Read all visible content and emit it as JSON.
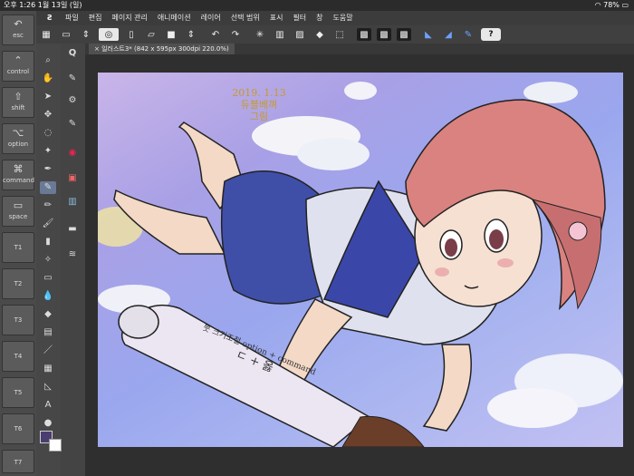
{
  "status": {
    "time": "오후 1:26",
    "date": "1월 13일 (일)",
    "battery": "78%"
  },
  "menu": {
    "items": [
      "파일",
      "편집",
      "페이지 관리",
      "애니메이션",
      "레이어",
      "선택 범위",
      "표시",
      "필터",
      "창",
      "도움말"
    ]
  },
  "keys": [
    {
      "label": "esc",
      "icon": "↶"
    },
    {
      "label": "control",
      "icon": "⌃"
    },
    {
      "label": "shift",
      "icon": "⇧"
    },
    {
      "label": "option",
      "icon": "⌥"
    },
    {
      "label": "command",
      "icon": "⌘"
    },
    {
      "label": "space",
      "icon": "▭"
    }
  ],
  "fkeys": [
    "T1",
    "T2",
    "T3",
    "T4",
    "T5",
    "T6",
    "T7"
  ],
  "tab": {
    "label": "일러스트3* (842 x 595px 300dpi 220.0%)"
  },
  "art": {
    "note_line1": "2019. 1.13",
    "note_line2": "듀블베껴",
    "note_line3": "그림",
    "board_text1": "붓 크기조절 option + command",
    "board_text2": "ㄷ + 옳"
  },
  "toolbar": {
    "help": "?"
  },
  "colors": {
    "main": "#4a3d70",
    "sub": "#ffffff"
  }
}
